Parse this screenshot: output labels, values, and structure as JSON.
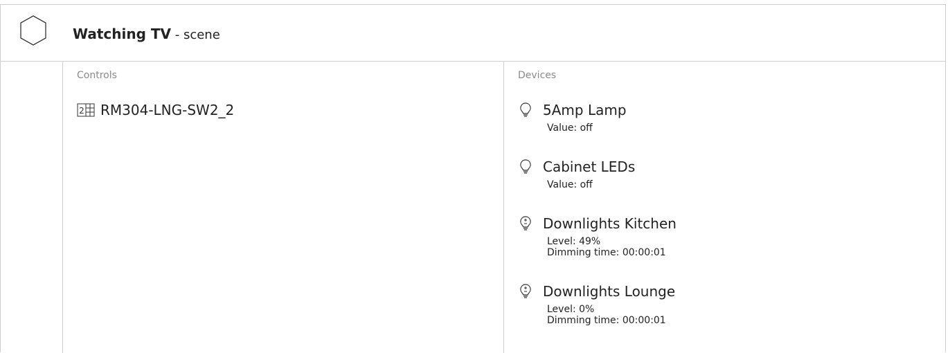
{
  "scene": {
    "icon": "hexagon-icon",
    "name": "Watching TV",
    "suffix": " - scene"
  },
  "controls": {
    "header": "Controls",
    "items": [
      {
        "icon": "keypad-2-icon",
        "label": "RM304-LNG-SW2_2"
      }
    ]
  },
  "devices": {
    "header": "Devices",
    "items": [
      {
        "icon": "bulb-icon",
        "name": "5Amp Lamp",
        "line1": "Value: off",
        "line2": ""
      },
      {
        "icon": "bulb-icon",
        "name": "Cabinet LEDs",
        "line1": "Value: off",
        "line2": ""
      },
      {
        "icon": "dimmable-bulb-icon",
        "name": "Downlights Kitchen",
        "line1": "Level: 49%",
        "line2": "Dimming time: 00:00:01"
      },
      {
        "icon": "dimmable-bulb-icon",
        "name": "Downlights Lounge",
        "line1": "Level: 0%",
        "line2": "Dimming time: 00:00:01"
      }
    ]
  }
}
